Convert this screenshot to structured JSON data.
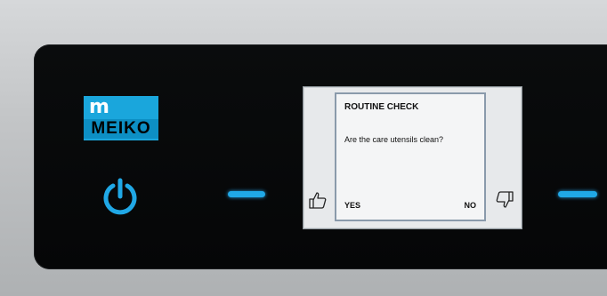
{
  "device": {
    "brand": "MEIKO",
    "logo_letter": "m"
  },
  "screen": {
    "dialog": {
      "title": "ROUTINE CHECK",
      "question": "Are the care utensils clean?",
      "yes_label": "YES",
      "no_label": "NO"
    }
  },
  "colors": {
    "accent_blue": "#20a8e6",
    "panel_black": "#050607",
    "logo_blue": "#1aa6dc"
  },
  "icons": {
    "power": "power-icon",
    "thumbs_up": "thumbs-up-icon",
    "thumbs_down": "thumbs-down-icon"
  }
}
